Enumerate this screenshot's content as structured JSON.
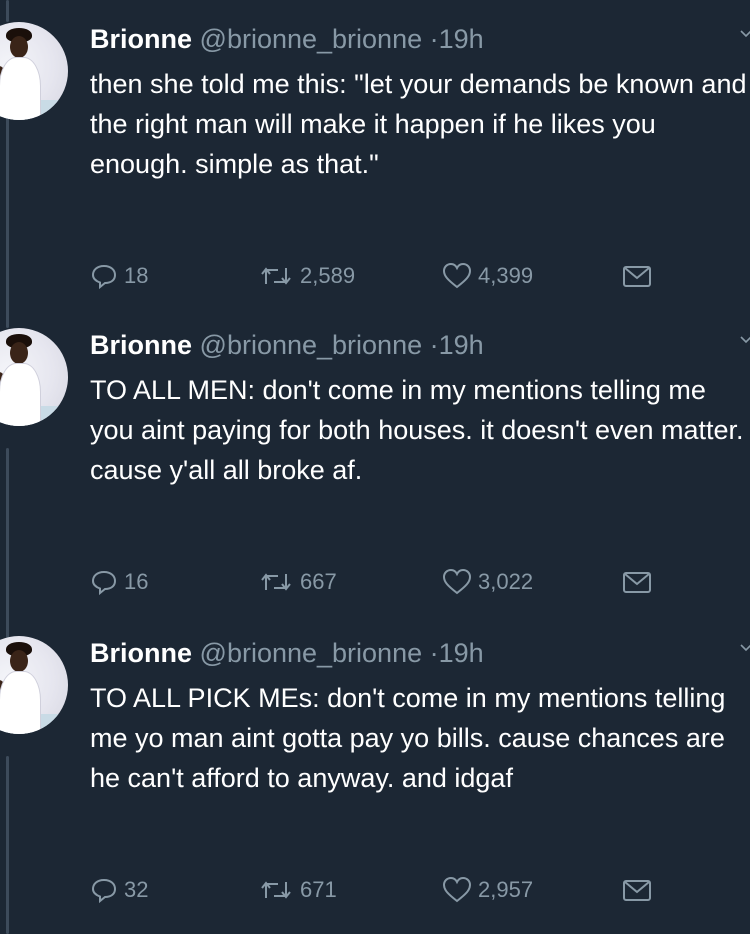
{
  "tweets": [
    {
      "name": "Brionne",
      "handle": "@brionne_brionne",
      "dot": "·",
      "time": "19h",
      "text": "then she told me this: \"let your demands be known and the right man will make it happen if he likes you enough. simple as that.\"",
      "replies": "18",
      "retweets": "2,589",
      "likes": "4,399"
    },
    {
      "name": "Brionne",
      "handle": "@brionne_brionne",
      "dot": "·",
      "time": "19h",
      "text": "TO ALL MEN: don't come in my mentions telling me you aint paying for both houses. it doesn't even matter. cause y'all all broke af.",
      "replies": "16",
      "retweets": "667",
      "likes": "3,022"
    },
    {
      "name": "Brionne",
      "handle": "@brionne_brionne",
      "dot": "·",
      "time": "19h",
      "text": "TO ALL PICK MEs: don't come in my mentions telling me yo man aint gotta pay yo bills. cause chances are he can't afford to anyway. and idgaf",
      "replies": "32",
      "retweets": "671",
      "likes": "2,957"
    }
  ],
  "colors": {
    "background": "#1c2734",
    "text": "#ffffff",
    "secondary": "#8899a6",
    "thread_line": "#3d4b5b"
  },
  "icons": [
    "reply-icon",
    "retweet-icon",
    "like-icon",
    "direct-message-icon",
    "chevron-down-icon"
  ]
}
